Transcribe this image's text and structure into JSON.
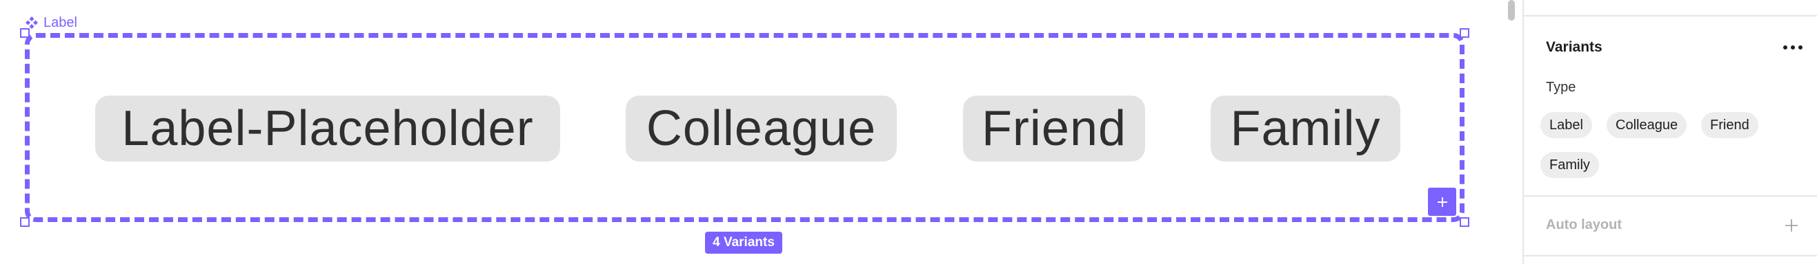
{
  "canvas": {
    "component_set_name": "Label",
    "variants": [
      "Label-Placeholder",
      "Colleague",
      "Friend",
      "Family"
    ],
    "variant_count_label": "4 Variants",
    "add_button_icon": "plus-icon",
    "accent_color": "#7b61ff"
  },
  "panel": {
    "section_title": "Variants",
    "more_icon": "more-horizontal-icon",
    "property": {
      "name": "Type",
      "values": [
        "Label",
        "Colleague",
        "Friend",
        "Family"
      ]
    },
    "auto_layout": {
      "title": "Auto layout",
      "add_icon": "plus-icon"
    }
  }
}
